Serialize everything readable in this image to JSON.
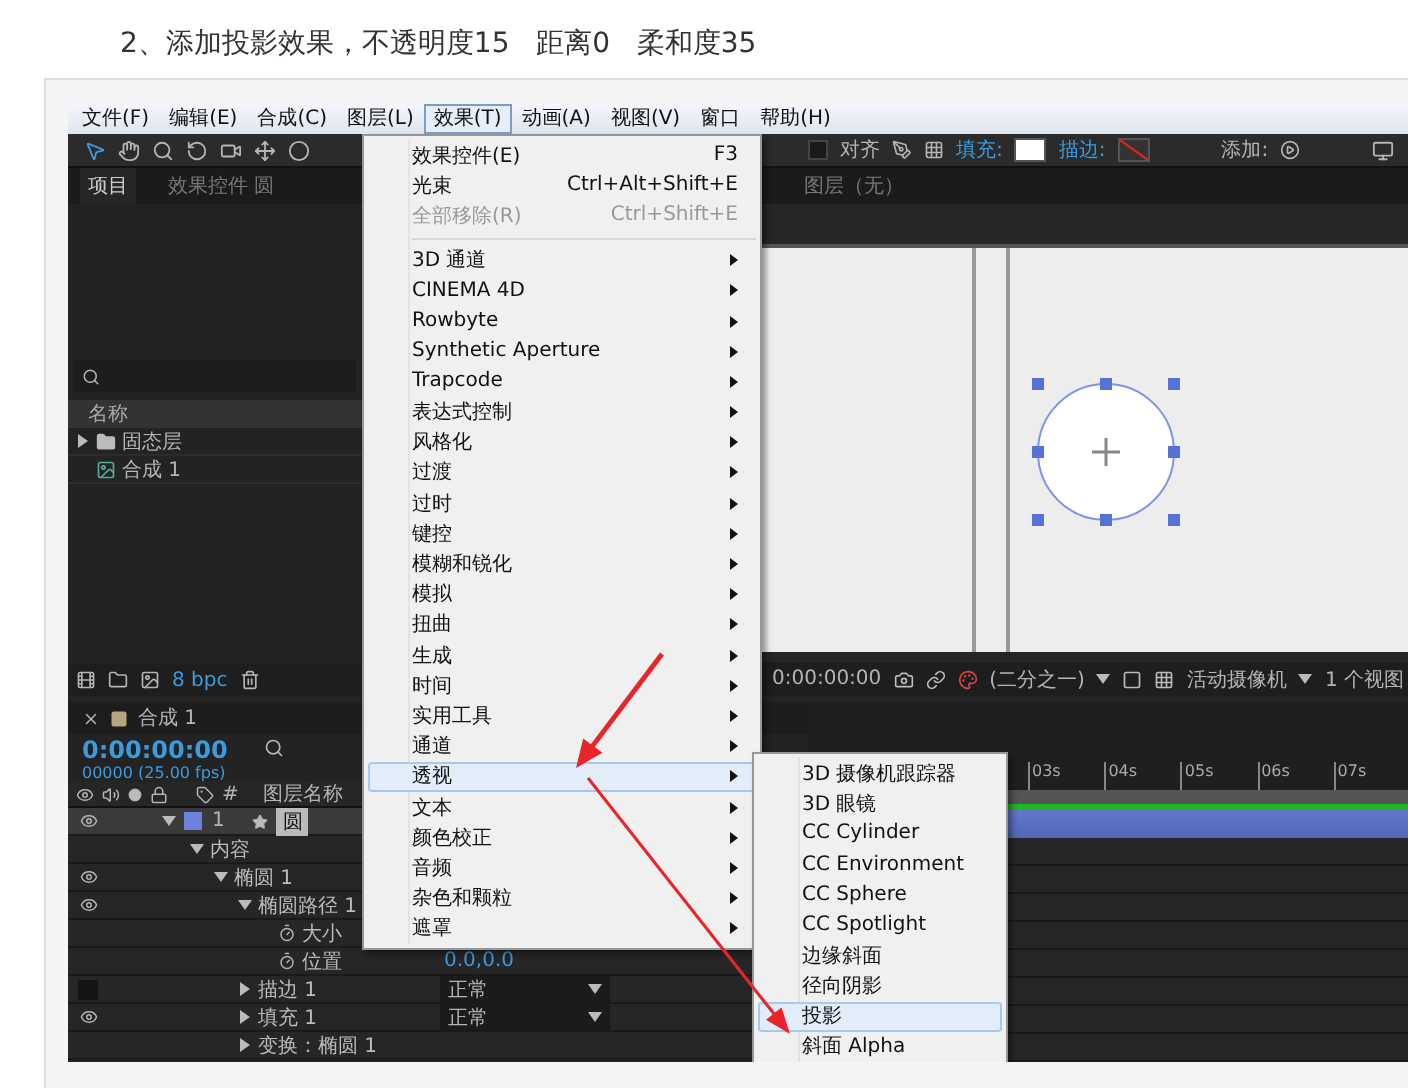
{
  "heading": "2、添加投影效果，不透明度15   距离0   柔和度35",
  "menubar": [
    {
      "label": "文件(F)",
      "selected": false
    },
    {
      "label": "编辑(E)",
      "selected": false
    },
    {
      "label": "合成(C)",
      "selected": false
    },
    {
      "label": "图层(L)",
      "selected": false
    },
    {
      "label": "效果(T)",
      "selected": true
    },
    {
      "label": "动画(A)",
      "selected": false
    },
    {
      "label": "视图(V)",
      "selected": false
    },
    {
      "label": "窗口",
      "selected": false
    },
    {
      "label": "帮助(H)",
      "selected": false
    }
  ],
  "toolbar": {
    "snap_label": "对齐",
    "snap_checked": false,
    "fill_label": "填充:",
    "stroke_label": "描边:",
    "add_label": "添加:"
  },
  "project_panel": {
    "tabs": [
      {
        "label": "项目",
        "selected": true
      },
      {
        "label": "效果控件 圆",
        "selected": false
      }
    ],
    "column": "名称",
    "items": [
      {
        "kind": "folder",
        "label": "固态层"
      },
      {
        "kind": "comp",
        "label": "合成 1"
      }
    ],
    "bpc": "8 bpc"
  },
  "composition": {
    "tab": "图层（无）",
    "timecode": "0:00:00:00",
    "resolution": "(二分之一)",
    "camera": "活动摄像机",
    "views": "1 个视图"
  },
  "timeline": {
    "tab": "合成 1",
    "timecode": "0:00:00:00",
    "fps": "00000 (25.00 fps)",
    "columns": [
      "#",
      "图层名称"
    ],
    "ruler": [
      "03s",
      "04s",
      "05s",
      "06s",
      "07s"
    ],
    "layers": [
      {
        "number": "1",
        "name": "圆",
        "expanded": true,
        "visible": true,
        "selected": true,
        "children": [
          {
            "name": "内容",
            "expanded": true,
            "children": [
              {
                "name": "椭圆 1",
                "expanded": true,
                "visible": true,
                "children": [
                  {
                    "name": "椭圆路径 1",
                    "expanded": true,
                    "visible": true,
                    "children": [
                      {
                        "name": "大小",
                        "kind": "stopwatch"
                      },
                      {
                        "name": "位置",
                        "kind": "stopwatch",
                        "value": "0.0,0.0"
                      }
                    ]
                  },
                  {
                    "name": "描边 1",
                    "expanded": false,
                    "visible": false,
                    "mode": "正常"
                  },
                  {
                    "name": "填充 1",
                    "expanded": false,
                    "visible": true,
                    "mode": "正常"
                  },
                  {
                    "name": "变换：椭圆 1",
                    "expanded": false
                  }
                ]
              }
            ]
          }
        ]
      }
    ]
  },
  "effect_menu": {
    "commands": [
      {
        "label": "效果控件(E)",
        "shortcut": "F3",
        "disabled": false
      },
      {
        "label": "光束",
        "shortcut": "Ctrl+Alt+Shift+E",
        "disabled": false
      },
      {
        "label": "全部移除(R)",
        "shortcut": "Ctrl+Shift+E",
        "disabled": true
      }
    ],
    "categories": [
      {
        "label": "3D 通道",
        "selected": false
      },
      {
        "label": "CINEMA 4D",
        "selected": false
      },
      {
        "label": "Rowbyte",
        "selected": false
      },
      {
        "label": "Synthetic Aperture",
        "selected": false
      },
      {
        "label": "Trapcode",
        "selected": false
      },
      {
        "label": "表达式控制",
        "selected": false
      },
      {
        "label": "风格化",
        "selected": false
      },
      {
        "label": "过渡",
        "selected": false
      },
      {
        "label": "过时",
        "selected": false
      },
      {
        "label": "键控",
        "selected": false
      },
      {
        "label": "模糊和锐化",
        "selected": false
      },
      {
        "label": "模拟",
        "selected": false
      },
      {
        "label": "扭曲",
        "selected": false
      },
      {
        "label": "生成",
        "selected": false
      },
      {
        "label": "时间",
        "selected": false
      },
      {
        "label": "实用工具",
        "selected": false
      },
      {
        "label": "通道",
        "selected": false
      },
      {
        "label": "透视",
        "selected": true
      },
      {
        "label": "文本",
        "selected": false
      },
      {
        "label": "颜色校正",
        "selected": false
      },
      {
        "label": "音频",
        "selected": false
      },
      {
        "label": "杂色和颗粒",
        "selected": false
      },
      {
        "label": "遮罩",
        "selected": false
      }
    ]
  },
  "submenu": [
    {
      "label": "3D 摄像机跟踪器",
      "selected": false
    },
    {
      "label": "3D 眼镜",
      "selected": false
    },
    {
      "label": "CC Cylinder",
      "selected": false
    },
    {
      "label": "CC Environment",
      "selected": false
    },
    {
      "label": "CC Sphere",
      "selected": false
    },
    {
      "label": "CC Spotlight",
      "selected": false
    },
    {
      "label": "边缘斜面",
      "selected": false
    },
    {
      "label": "径向阴影",
      "selected": false
    },
    {
      "label": "投影",
      "selected": true
    },
    {
      "label": "斜面 Alpha",
      "selected": false
    }
  ]
}
